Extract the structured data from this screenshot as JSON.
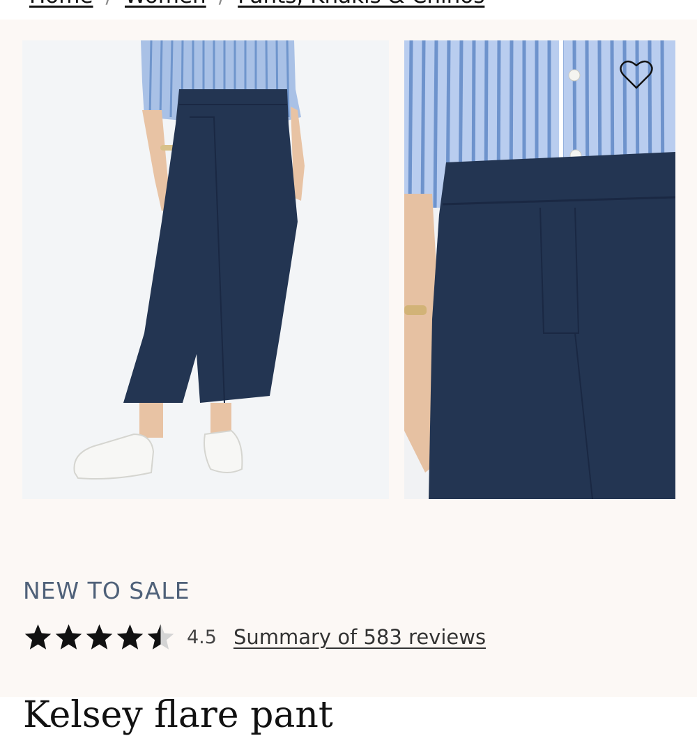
{
  "breadcrumb": {
    "items": [
      "Home",
      "Women",
      "Pants, Khakis & Chinos"
    ],
    "separator": "/"
  },
  "gallery": {
    "main_image": "full-length navy flare pants outfit",
    "detail_image": "close-up navy pants waistband",
    "wishlist_icon": "heart-icon"
  },
  "product": {
    "sale_tag": "NEW TO SALE",
    "rating_value": "4.5",
    "rating_stars": 4.5,
    "reviews_link": "Summary of 583 reviews",
    "title": "Kelsey flare pant"
  },
  "colors": {
    "panel_bg": "#fcf8f5",
    "sale_tag": "#4f6179",
    "pants_navy": "#233552",
    "shirt_stripe": "#6f95cc"
  }
}
